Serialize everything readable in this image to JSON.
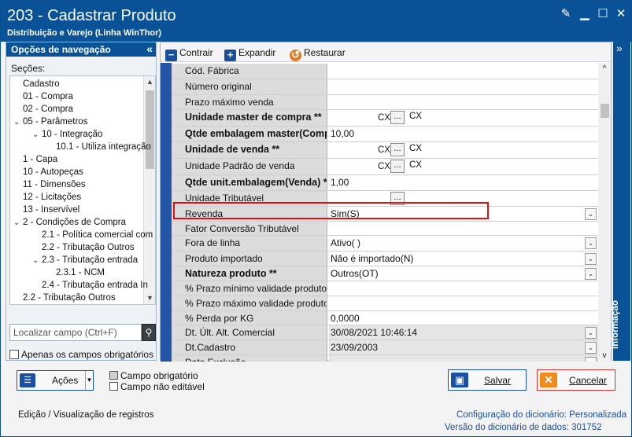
{
  "window": {
    "title": "203 - Cadastrar  Produto",
    "subtitle": "Distribuição e Varejo (Linha WinThor)"
  },
  "colors": {
    "titlebar": "#0a5298",
    "accent": "#2456a8",
    "highlight": "#e01010"
  },
  "sidebar": {
    "header": "Opções de navegação",
    "section_label": "Seções:",
    "tree": [
      {
        "label": "Cadastro",
        "level": 1,
        "toggle": ""
      },
      {
        "label": "01 - Compra",
        "level": 1,
        "toggle": ""
      },
      {
        "label": "02 - Compra",
        "level": 1,
        "toggle": ""
      },
      {
        "label": "05 - Parâmetros",
        "level": 1,
        "toggle": "v"
      },
      {
        "label": "10 - Integração",
        "level": 2,
        "toggle": "v"
      },
      {
        "label": "10.1 - Utiliza integração",
        "level": 3,
        "toggle": ""
      },
      {
        "label": "1 - Capa",
        "level": 1,
        "toggle": ""
      },
      {
        "label": "10 - Autopeças",
        "level": 1,
        "toggle": ""
      },
      {
        "label": "11 - Dimensões",
        "level": 1,
        "toggle": ""
      },
      {
        "label": "12 - Licitações",
        "level": 1,
        "toggle": ""
      },
      {
        "label": "13 - Inservível",
        "level": 1,
        "toggle": ""
      },
      {
        "label": "2 - Condições de Compra",
        "level": 1,
        "toggle": "v"
      },
      {
        "label": "2.1 - Política comercial com",
        "level": 2,
        "toggle": ""
      },
      {
        "label": "2.2 - Tributação Outros",
        "level": 2,
        "toggle": ""
      },
      {
        "label": "2.3 - Tributação entrada",
        "level": 2,
        "toggle": "v"
      },
      {
        "label": "2.3.1 - NCM",
        "level": 3,
        "toggle": ""
      },
      {
        "label": "2.4 - Tributação entrada In",
        "level": 2,
        "toggle": ""
      },
      {
        "label": "2.2 - Tributação Outros",
        "level": 1,
        "toggle": ""
      }
    ],
    "search_placeholder": "Localizar campo (Ctrl+F)",
    "only_required_label": "Apenas os campos obrigatórios"
  },
  "toolbar": {
    "contract": "Contrair",
    "expand": "Expandir",
    "restore": "Restaurar"
  },
  "fields": [
    {
      "label": "Cód. Fábrica",
      "value": "",
      "bold": false
    },
    {
      "label": "Número original",
      "value": "",
      "bold": false
    },
    {
      "label": "Prazo máximo venda",
      "value": "",
      "bold": false
    },
    {
      "label": "Unidade master de compra **",
      "value": "",
      "bold": true,
      "unit": "CX",
      "unit2": "CX"
    },
    {
      "label": "Qtde embalagem master(Comp",
      "value": "10,00",
      "bold": true
    },
    {
      "label": "Unidade de venda **",
      "value": "",
      "bold": true,
      "unit": "CX",
      "unit2": "CX"
    },
    {
      "label": "Unidade Padrão de venda",
      "value": "",
      "bold": false,
      "unit": "CX",
      "unit2": "CX"
    },
    {
      "label": "Qtde unit.embalagem(Venda) *",
      "value": "1,00",
      "bold": true
    },
    {
      "label": "Unidade Tributável",
      "value": "",
      "bold": false,
      "ellipsis": true
    },
    {
      "label": "Revenda",
      "value": "Sim(S)",
      "bold": false,
      "dropdown": true
    },
    {
      "label": "Fator Conversão Tributável",
      "value": "",
      "bold": false
    },
    {
      "label": "Fora de linha",
      "value": "Ativo(  )",
      "bold": false,
      "dropdown": true
    },
    {
      "label": "Produto importado",
      "value": "Não é importado(N)",
      "bold": false,
      "dropdown": true
    },
    {
      "label": "Natureza produto **",
      "value": "Outros(OT)",
      "bold": true,
      "dropdown": true
    },
    {
      "label": "% Prazo mínimo validade produto",
      "value": "",
      "bold": false
    },
    {
      "label": "% Prazo máximo validade produto",
      "value": "",
      "bold": false
    },
    {
      "label": "% Perda por KG",
      "value": "0,0000",
      "bold": false
    },
    {
      "label": "Dt. Últ. Alt. Comercial",
      "value": "30/08/2021 10:46:14",
      "bold": false,
      "dropdown": true,
      "gray": true
    },
    {
      "label": "Dt.Cadastro",
      "value": "23/09/2003",
      "bold": false,
      "dropdown": true,
      "gray": true
    },
    {
      "label": "Data Exclusão",
      "value": "",
      "bold": false,
      "dropdown": true,
      "gray": true
    }
  ],
  "ellipsis_glyph": "...",
  "info_panel": {
    "label": "Informação"
  },
  "actions": {
    "label": "Ações"
  },
  "legend": {
    "required": "Campo obrigatório",
    "readonly": "Campo não editável"
  },
  "buttons": {
    "save": "Salvar",
    "cancel": "Cancelar"
  },
  "footer": {
    "status": "Edição / Visualização de registros",
    "dict_config_label": "Configuração do dicionário:",
    "dict_config_value": "Personalizada",
    "dict_version_label": "Versão do dicionário de dados:",
    "dict_version_value": "301752"
  }
}
